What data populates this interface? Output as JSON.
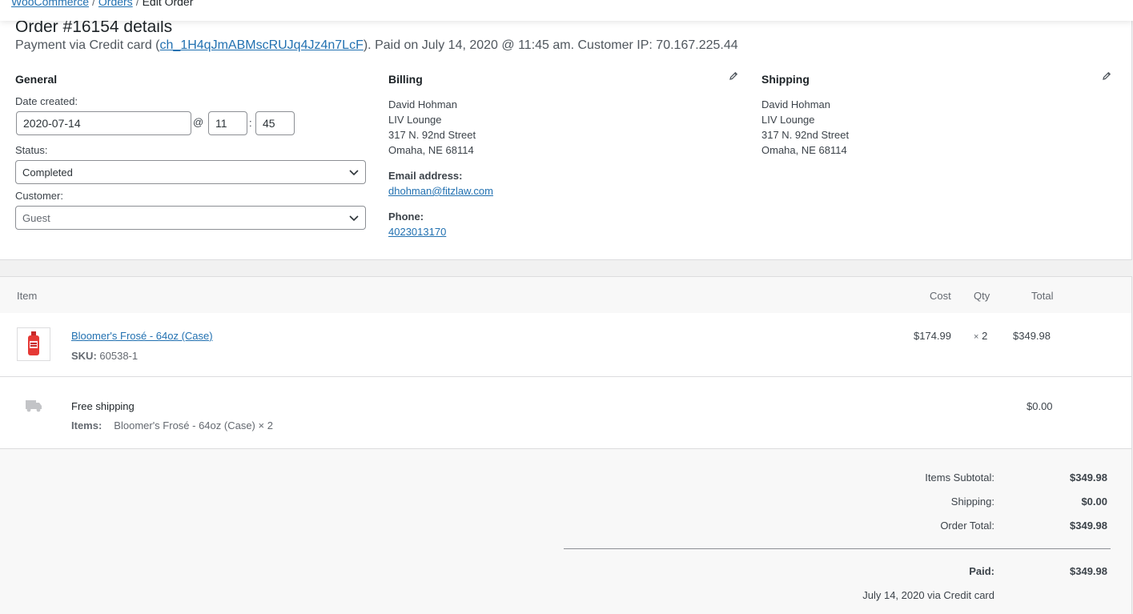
{
  "breadcrumb": {
    "woocommerce": "WooCommerce",
    "orders": "Orders",
    "current": "Edit Order",
    "separator": "/"
  },
  "order": {
    "title": "Order #16154 details",
    "payment_prefix": "Payment via Credit card (",
    "charge_id": "ch_1H4qJmABMscRUJq4Jz4n7LcF",
    "payment_suffix": "). Paid on July 14, 2020 @ 11:45 am. Customer IP: 70.167.225.44"
  },
  "general": {
    "heading": "General",
    "date_label": "Date created:",
    "date": "2020-07-14",
    "at": "@",
    "hour": "11",
    "colon": ":",
    "minute": "45",
    "status_label": "Status:",
    "status": "Completed",
    "customer_label": "Customer:",
    "customer": "Guest"
  },
  "billing": {
    "heading": "Billing",
    "name": "David Hohman",
    "company": "LIV Lounge",
    "street": "317 N. 92nd Street",
    "city": "Omaha, NE 68114",
    "email_label": "Email address:",
    "email": "dhohman@fitzlaw.com",
    "phone_label": "Phone:",
    "phone": "4023013170"
  },
  "shipping": {
    "heading": "Shipping",
    "name": "David Hohman",
    "company": "LIV Lounge",
    "street": "317 N. 92nd Street",
    "city": "Omaha, NE 68114"
  },
  "items_table": {
    "headers": {
      "item": "Item",
      "cost": "Cost",
      "qty": "Qty",
      "total": "Total"
    },
    "rows": [
      {
        "name": "Bloomer's Frosé - 64oz (Case)",
        "sku_label": "SKU:",
        "sku": "60538-1",
        "cost": "$174.99",
        "qty_prefix": "×",
        "qty": "2",
        "total": "$349.98"
      }
    ],
    "shipping_line": {
      "method": "Free shipping",
      "items_label": "Items:",
      "items": "Bloomer's Frosé - 64oz (Case) × 2",
      "total": "$0.00"
    }
  },
  "totals": {
    "subtotal_label": "Items Subtotal:",
    "subtotal": "$349.98",
    "shipping_label": "Shipping:",
    "shipping": "$0.00",
    "order_total_label": "Order Total:",
    "order_total": "$349.98",
    "paid_label": "Paid:",
    "paid": "$349.98",
    "paid_note": "July 14, 2020 via Credit card"
  },
  "colors": {
    "link": "#2271b1",
    "text": "#3c434a",
    "border": "#dcdcde",
    "panel_bg": "#f8f8f8"
  },
  "icons": [
    "pencil-icon",
    "chevron-down-icon",
    "truck-icon",
    "product-thumbnail"
  ]
}
